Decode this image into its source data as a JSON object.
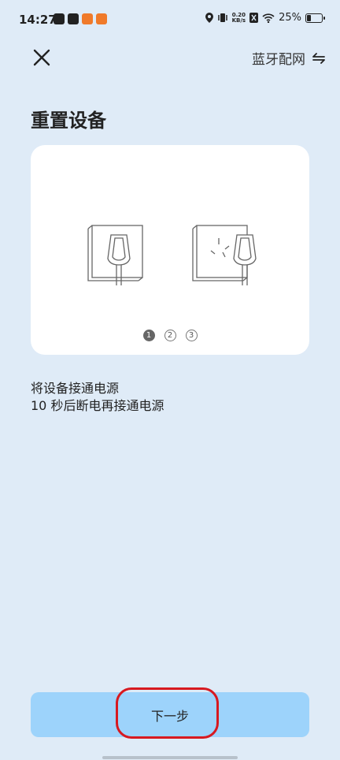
{
  "status_bar": {
    "time": "14:27",
    "net_speed_top": "0.20",
    "net_speed_bottom": "KB/s",
    "battery_percent": "25%"
  },
  "nav": {
    "bluetooth_label": "蓝牙配网",
    "close_icon": "close-icon",
    "switch_icon": "swap-arrows-icon"
  },
  "page": {
    "title": "重置设备"
  },
  "carousel": {
    "pages": [
      "1",
      "2",
      "3"
    ],
    "active_index": 0
  },
  "instructions": {
    "line1": "将设备接通电源",
    "line2": "10 秒后断电再接通电源"
  },
  "footer": {
    "next_label": "下一步"
  },
  "colors": {
    "background": "#dfebf7",
    "button": "#9dd3fb",
    "highlight": "#d71920"
  }
}
